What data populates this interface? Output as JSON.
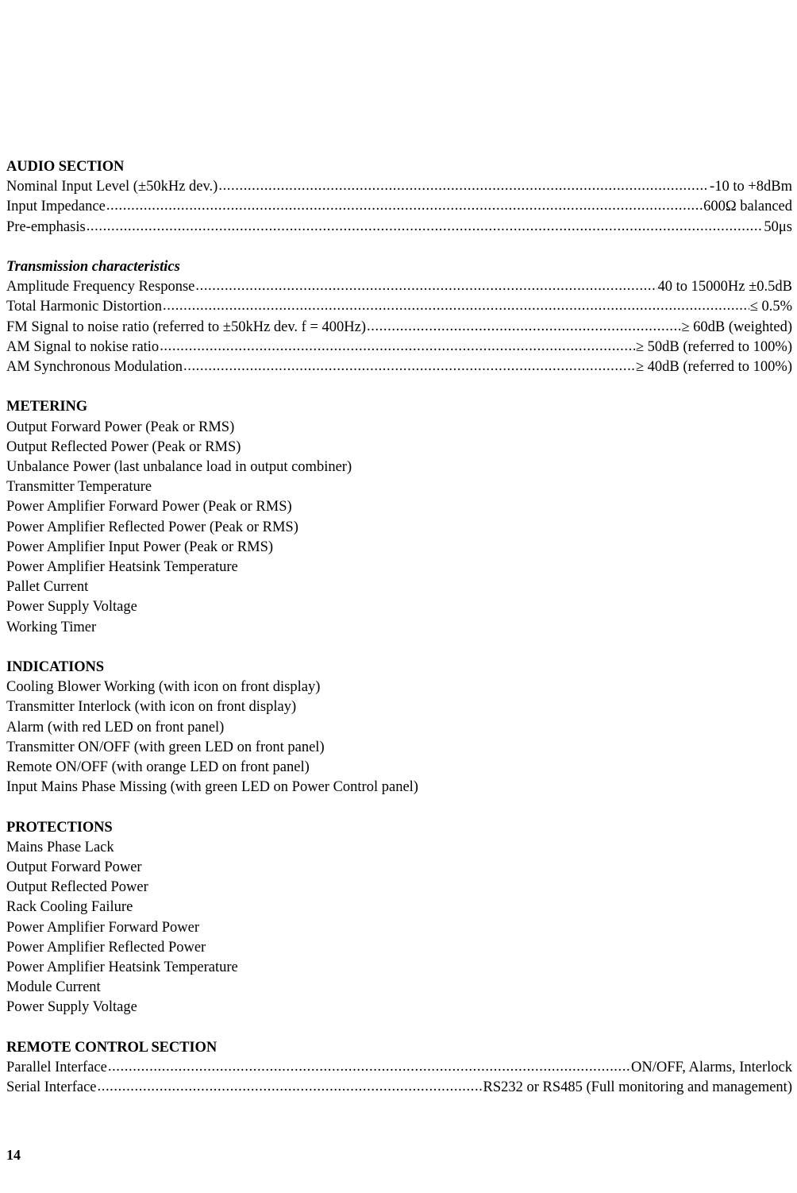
{
  "page": {
    "number": "14"
  },
  "sections": [
    {
      "id": "audio",
      "title": "AUDIO SECTION",
      "title_style": "bold",
      "rows": [
        {
          "type": "dotted",
          "label": "Nominal Input Level (±50kHz dev.)",
          "value": "-10 to +8dBm"
        },
        {
          "type": "dotted",
          "label": "Input Impedance",
          "value": "600Ω balanced"
        },
        {
          "type": "dotted",
          "label": "Pre-emphasis",
          "value": "50μs"
        }
      ]
    },
    {
      "id": "transmission",
      "title": "Transmission characteristics",
      "title_style": "bold-italic",
      "rows": [
        {
          "type": "dotted",
          "label": "Amplitude Frequency Response",
          "value": "40 to 15000Hz ±0.5dB"
        },
        {
          "type": "dotted",
          "label": "Total Harmonic Distortion",
          "value": "≤ 0.5%"
        },
        {
          "type": "dotted",
          "label": "FM Signal to noise ratio (referred to ±50kHz dev. f = 400Hz)",
          "value": "≥ 60dB (weighted)"
        },
        {
          "type": "dotted",
          "label": "AM Signal to nokise ratio",
          "value": "≥ 50dB (referred to 100%)"
        },
        {
          "type": "dotted",
          "label": "AM Synchronous Modulation",
          "value": "≥ 40dB (referred to 100%)"
        }
      ]
    },
    {
      "id": "metering",
      "title": "METERING",
      "title_style": "bold",
      "rows": [
        {
          "type": "plain",
          "label": "Output Forward Power (Peak or RMS)"
        },
        {
          "type": "plain",
          "label": "Output Reflected Power (Peak or RMS)"
        },
        {
          "type": "plain",
          "label": "Unbalance Power (last unbalance load in output combiner)"
        },
        {
          "type": "plain",
          "label": "Transmitter Temperature"
        },
        {
          "type": "plain",
          "label": "Power Amplifier Forward Power (Peak or RMS)"
        },
        {
          "type": "plain",
          "label": "Power Amplifier Reflected Power (Peak or RMS)"
        },
        {
          "type": "plain",
          "label": "Power Amplifier Input Power (Peak or RMS)"
        },
        {
          "type": "plain",
          "label": "Power Amplifier Heatsink Temperature"
        },
        {
          "type": "plain",
          "label": "Pallet Current"
        },
        {
          "type": "plain",
          "label": "Power Supply Voltage"
        },
        {
          "type": "plain",
          "label": "Working Timer"
        }
      ]
    },
    {
      "id": "indications",
      "title": "INDICATIONS",
      "title_style": "bold",
      "rows": [
        {
          "type": "plain",
          "label": "Cooling Blower Working (with icon on front display)"
        },
        {
          "type": "plain",
          "label": "Transmitter Interlock (with icon on front display)"
        },
        {
          "type": "plain",
          "label": "Alarm (with red LED on front panel)"
        },
        {
          "type": "plain",
          "label": "Transmitter ON/OFF (with green LED on front panel)"
        },
        {
          "type": "plain",
          "label": "Remote ON/OFF (with orange LED on front panel)"
        },
        {
          "type": "plain",
          "label": "Input Mains Phase Missing (with green LED on Power Control panel)"
        }
      ]
    },
    {
      "id": "protections",
      "title": "PROTECTIONS",
      "title_style": "bold",
      "rows": [
        {
          "type": "plain",
          "label": "Mains Phase Lack"
        },
        {
          "type": "plain",
          "label": "Output Forward Power"
        },
        {
          "type": "plain",
          "label": "Output Reflected Power"
        },
        {
          "type": "plain",
          "label": "Rack Cooling Failure"
        },
        {
          "type": "plain",
          "label": "Power Amplifier Forward Power"
        },
        {
          "type": "plain",
          "label": "Power Amplifier Reflected Power"
        },
        {
          "type": "plain",
          "label": "Power Amplifier Heatsink Temperature"
        },
        {
          "type": "plain",
          "label": "Module Current"
        },
        {
          "type": "plain",
          "label": "Power Supply Voltage"
        }
      ]
    },
    {
      "id": "remote-control",
      "title": "REMOTE CONTROL SECTION",
      "title_style": "bold",
      "rows": [
        {
          "type": "dotted",
          "label": "Parallel Interface",
          "value": "ON/OFF, Alarms, Interlock"
        },
        {
          "type": "dotted",
          "label": "Serial Interface",
          "value": "RS232 or RS485 (Full monitoring and management)"
        }
      ]
    }
  ]
}
